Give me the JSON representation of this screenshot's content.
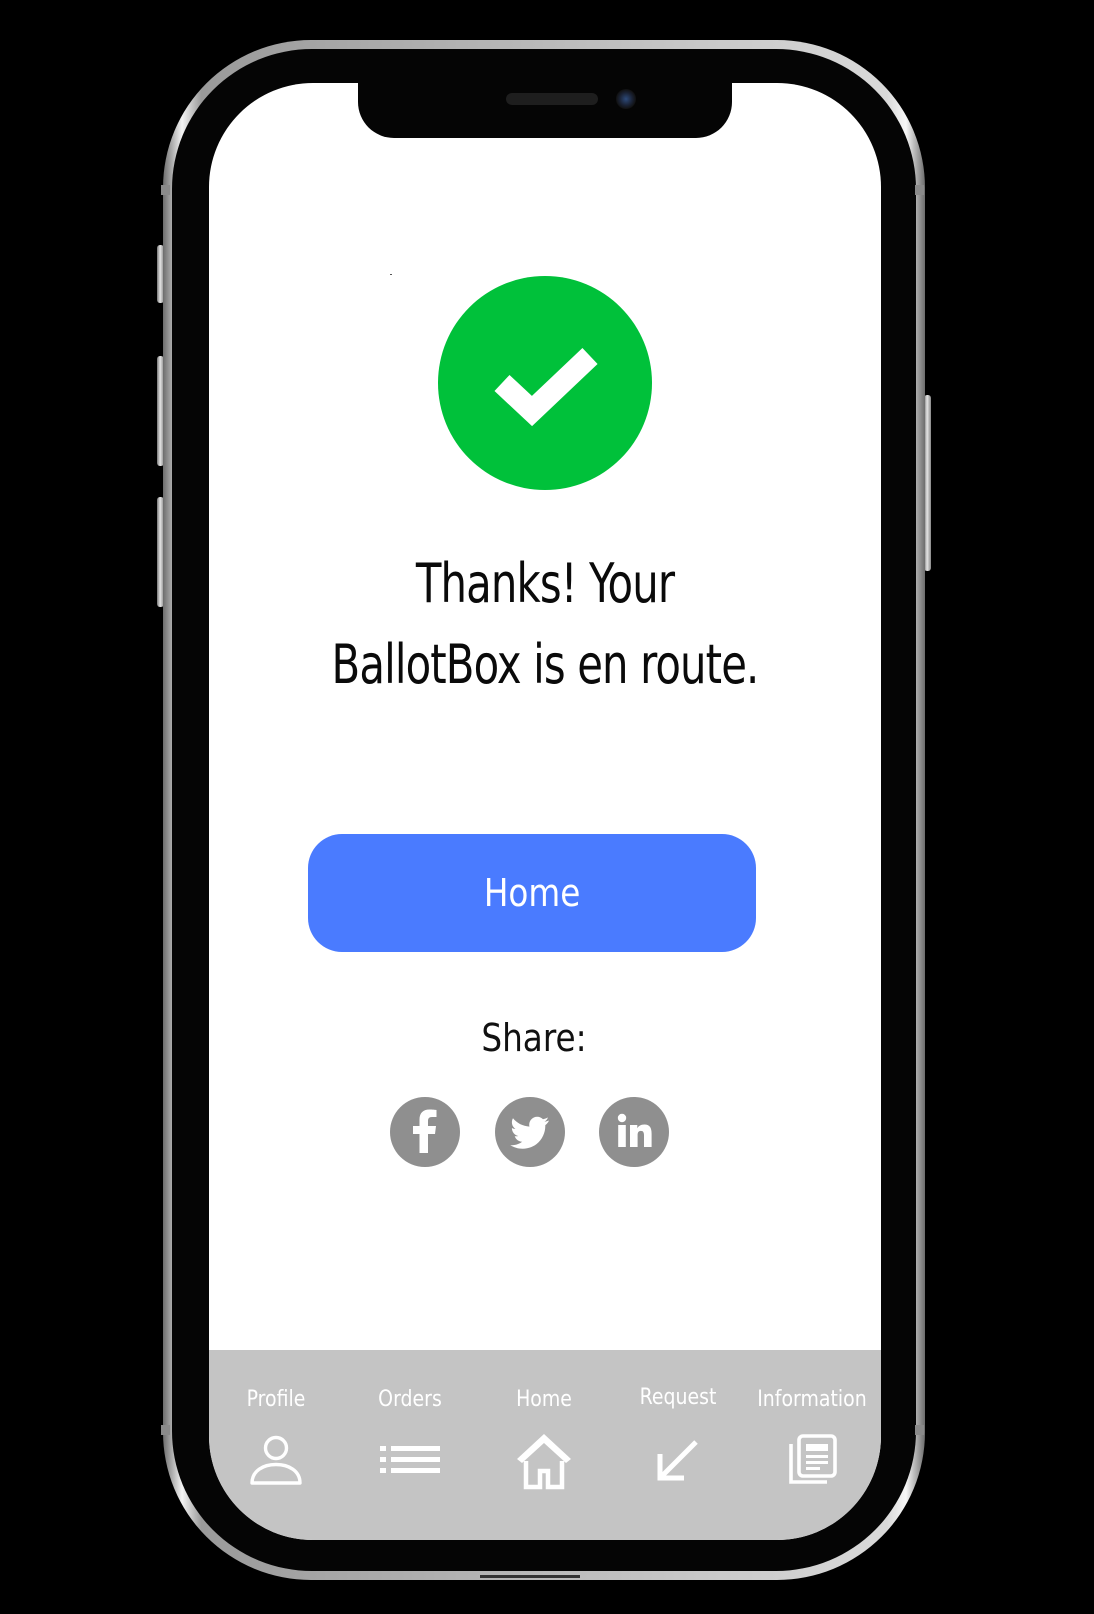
{
  "app": "BallotBox",
  "confirmation": {
    "icon": "checkmark-icon",
    "success_color": "#00c13a",
    "headline_line1": "Thanks! Your",
    "headline_line2": "BallotBox is en route."
  },
  "primary_action": {
    "label": "Home",
    "color": "#4a7bff"
  },
  "share": {
    "label": "Share:",
    "icon_color": "#8f8f8f",
    "networks": [
      {
        "name": "Facebook",
        "icon": "facebook-icon"
      },
      {
        "name": "Twitter",
        "icon": "twitter-icon"
      },
      {
        "name": "LinkedIn",
        "icon": "linkedin-icon"
      }
    ]
  },
  "tabbar": {
    "background": "#c4c4c4",
    "items": [
      {
        "label": "Profile",
        "icon": "person-icon"
      },
      {
        "label": "Orders",
        "icon": "list-icon"
      },
      {
        "label": "Home",
        "icon": "house-icon"
      },
      {
        "label": "Request",
        "icon": "arrow-down-left-icon"
      },
      {
        "label": "Information",
        "icon": "newspaper-icon"
      }
    ]
  }
}
